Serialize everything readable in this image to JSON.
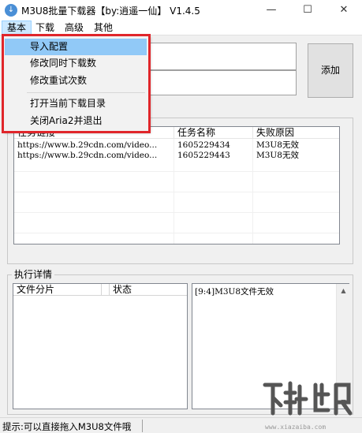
{
  "window": {
    "title": "M3U8批量下载器【by:逍遥一仙】 V1.4.5",
    "icon": "download-icon"
  },
  "menubar": [
    {
      "label": "基本",
      "active": true
    },
    {
      "label": "下载"
    },
    {
      "label": "高级"
    },
    {
      "label": "其他"
    }
  ],
  "dropdown": {
    "items": [
      {
        "label": "导入配置"
      },
      {
        "label": "修改同时下载数"
      },
      {
        "label": "修改重试次数"
      },
      {
        "label": "打开当前下载目录"
      },
      {
        "label": "关闭Aria2并退出"
      }
    ],
    "highlight_color": "#e0262b"
  },
  "add_button": {
    "label": "添加"
  },
  "task_list": {
    "columns": [
      "任务链接",
      "任务名称",
      "失败原因"
    ],
    "rows": [
      {
        "url": "https://www.b.29cdn.com/video...",
        "name": "1605229434",
        "reason": "M3U8无效"
      },
      {
        "url": "https://www.b.29cdn.com/video...",
        "name": "1605229443",
        "reason": "M3U8无效"
      }
    ]
  },
  "details": {
    "title": "执行详情",
    "columns": [
      "文件分片",
      "状态"
    ],
    "log": "[9:4]M3U8文件无效"
  },
  "statusbar": {
    "text": "提示:可以直接拖入M3U8文件哦"
  },
  "watermark": {
    "text": "www.xiazaiba.com"
  },
  "colors": {
    "accent": "#91c9f7",
    "highlight": "#e0262b"
  }
}
